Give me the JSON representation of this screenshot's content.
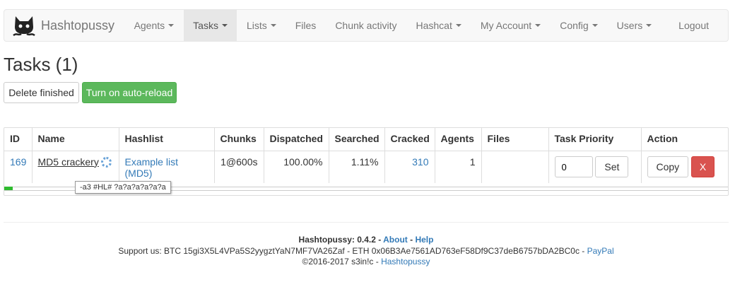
{
  "navbar": {
    "brand": "Hashtopussy",
    "items": [
      {
        "label": "Agents",
        "dropdown": true
      },
      {
        "label": "Tasks",
        "dropdown": true,
        "active": true
      },
      {
        "label": "Lists",
        "dropdown": true
      },
      {
        "label": "Files",
        "dropdown": false
      },
      {
        "label": "Chunk activity",
        "dropdown": false
      },
      {
        "label": "Hashcat",
        "dropdown": true
      },
      {
        "label": "My Account",
        "dropdown": true
      },
      {
        "label": "Config",
        "dropdown": true
      },
      {
        "label": "Users",
        "dropdown": true
      }
    ],
    "logout": "Logout"
  },
  "page": {
    "title": "Tasks (1)",
    "delete_finished": "Delete finished",
    "auto_reload": "Turn on auto-reload"
  },
  "table": {
    "headers": [
      "ID",
      "Name",
      "Hashlist",
      "Chunks",
      "Dispatched",
      "Searched",
      "Cracked",
      "Agents",
      "Files",
      "Task Priority",
      "Action"
    ],
    "rows": [
      {
        "id": "169",
        "name": "MD5 crackery",
        "hashlist": "Example list (MD5)",
        "chunks": "1@600s",
        "dispatched": "100.00%",
        "searched": "1.11%",
        "cracked": "310",
        "agents": "1",
        "files": "",
        "priority": "0",
        "set_label": "Set",
        "copy_label": "Copy",
        "delete_label": "X",
        "progress": 0.0111,
        "tooltip": "-a3 #HL# ?a?a?a?a?a?a"
      }
    ]
  },
  "footer": {
    "version_prefix": "Hashtopussy: 0.4.2",
    "sep1": " - ",
    "about": "About",
    "sep2": " - ",
    "help": "Help",
    "support_text": "Support us: BTC 15gi3X5L4VPa5S2yygztYaN7MF7VA26Zaf - ETH 0x06B3Ae7561AD763eF58Df9C37deB6757bDA2BC0c - ",
    "paypal": "PayPal",
    "copyright": "©2016-2017 s3in!c - ",
    "copyright_link": "Hashtopussy"
  },
  "colors": {
    "success": "#5cb85c",
    "danger": "#d9534f",
    "link": "#337ab7",
    "progress": "#2fbb2f"
  }
}
